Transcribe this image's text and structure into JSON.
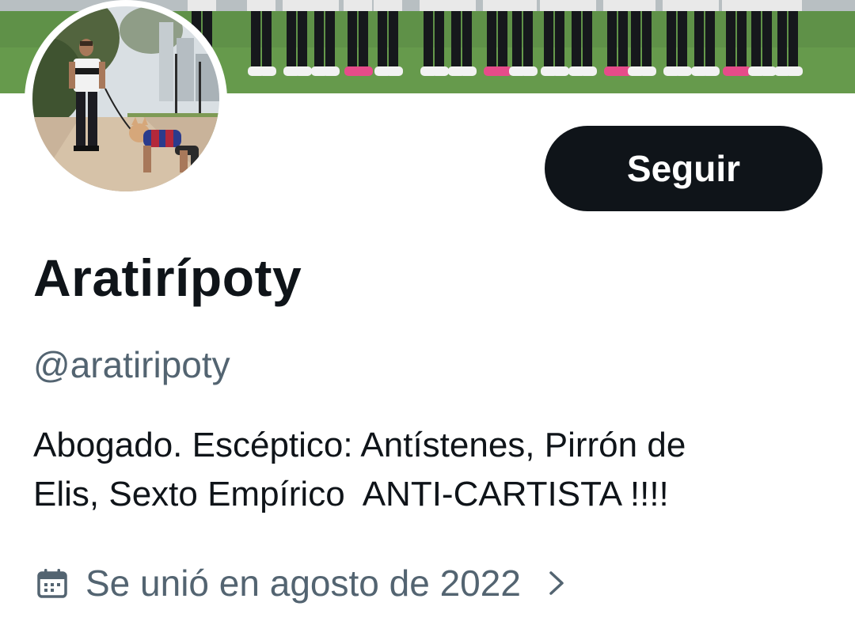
{
  "profile": {
    "display_name": "Aratirípoty",
    "handle": "@aratiripoty",
    "bio_lines": [
      "Abogado. Escéptico: Antístenes, Pirrón de",
      "Elis, Sexto Empírico  ANTI-CARTISTA !!!!"
    ],
    "joined": "Se unió en agosto de 2022"
  },
  "actions": {
    "follow_label": "Seguir"
  },
  "icons": {
    "joined": "calendar-icon",
    "expand": "chevron-right-icon"
  },
  "colors": {
    "text_primary": "#0f1419",
    "text_secondary": "#536471",
    "button_bg": "#0f1419",
    "button_text": "#ffffff",
    "pitch_green": "#5e8f47"
  }
}
